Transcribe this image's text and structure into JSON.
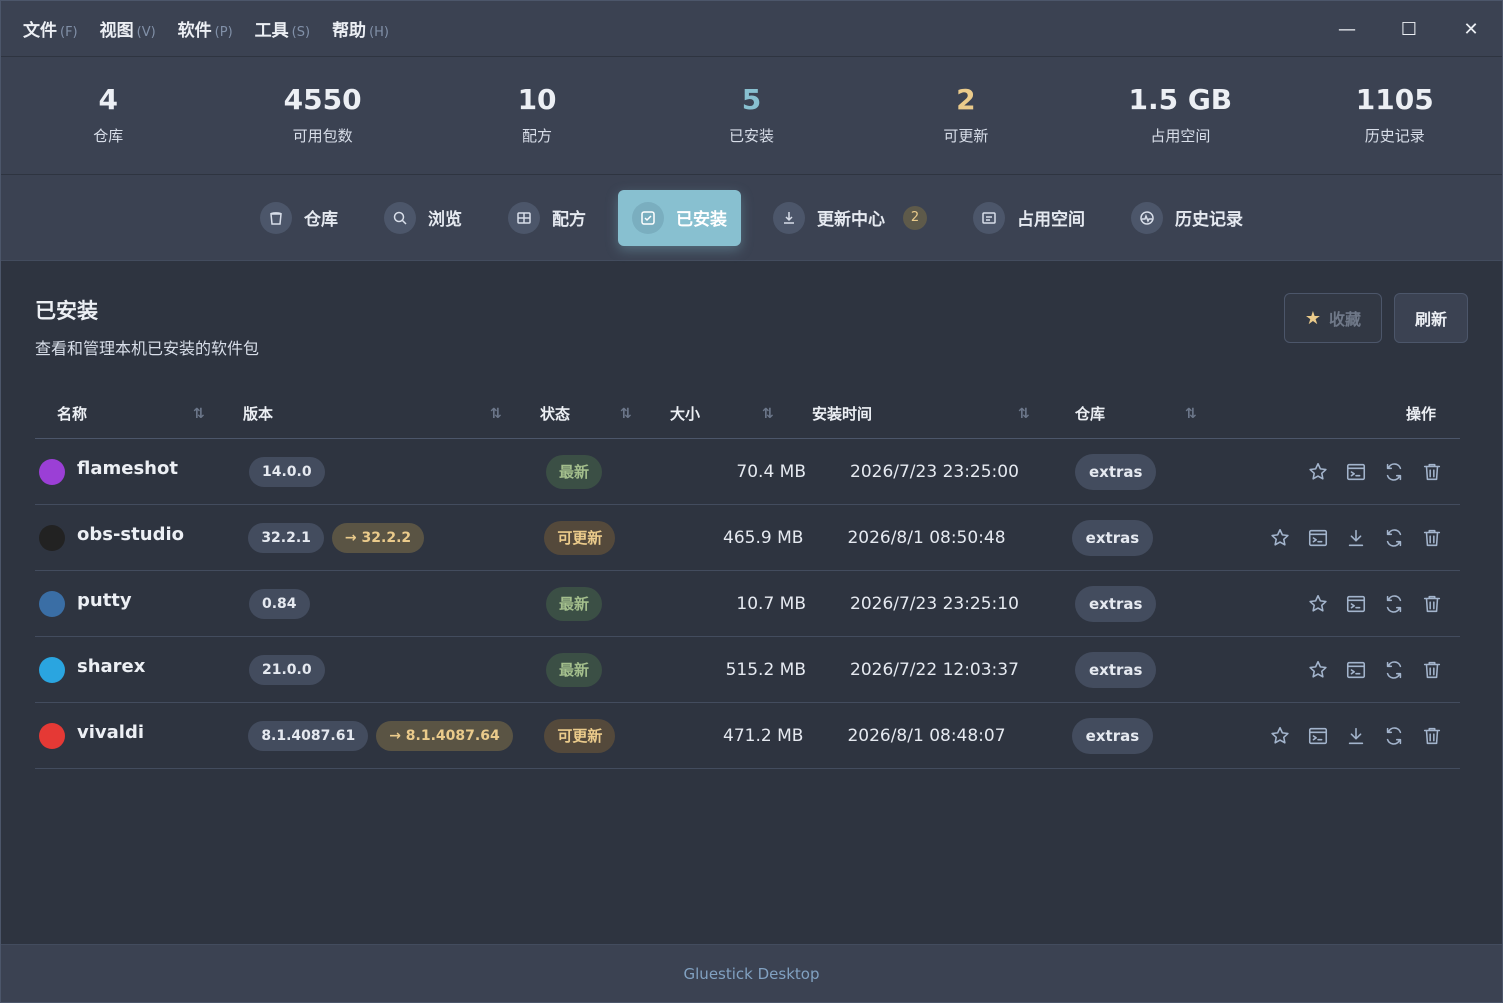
{
  "menu": [
    {
      "label": "文件",
      "key": "(F)"
    },
    {
      "label": "视图",
      "key": "(V)"
    },
    {
      "label": "软件",
      "key": "(P)"
    },
    {
      "label": "工具",
      "key": "(S)"
    },
    {
      "label": "帮助",
      "key": "(H)"
    }
  ],
  "window_controls": {
    "minimize": "—",
    "maximize": "☐",
    "close": "✕"
  },
  "stats": [
    {
      "value": "4",
      "label": "仓库",
      "color": "#eceff4"
    },
    {
      "value": "4550",
      "label": "可用包数",
      "color": "#eceff4"
    },
    {
      "value": "10",
      "label": "配方",
      "color": "#eceff4"
    },
    {
      "value": "5",
      "label": "已安装",
      "color": "#88c0d0"
    },
    {
      "value": "2",
      "label": "可更新",
      "color": "#ebcb8b"
    },
    {
      "value": "1.5 GB",
      "label": "占用空间",
      "color": "#eceff4"
    },
    {
      "value": "1105",
      "label": "历史记录",
      "color": "#eceff4"
    }
  ],
  "nav": [
    {
      "label": "仓库",
      "icon": "bucket-icon"
    },
    {
      "label": "浏览",
      "icon": "search-icon"
    },
    {
      "label": "配方",
      "icon": "recipe-icon"
    },
    {
      "label": "已安装",
      "icon": "installed-icon"
    },
    {
      "label": "更新中心",
      "icon": "download-icon",
      "badge": "2"
    },
    {
      "label": "占用空间",
      "icon": "storage-icon"
    },
    {
      "label": "历史记录",
      "icon": "history-icon"
    }
  ],
  "page": {
    "title": "已安装",
    "subtitle": "查看和管理本机已安装的软件包",
    "favorites_label": "收藏",
    "refresh_label": "刷新"
  },
  "table": {
    "headers": {
      "name": "名称",
      "version": "版本",
      "status": "状态",
      "size": "大小",
      "time": "安装时间",
      "repo": "仓库",
      "ops": "操作"
    },
    "sort_glyph": "⇅",
    "rows": [
      {
        "name": "flameshot",
        "version": "14.0.0",
        "new_version": "",
        "status": "最新",
        "status_type": "ok",
        "size": "70.4 MB",
        "time": "2026/7/23 23:25:00",
        "repo": "extras",
        "icon_color": "#9b3fd6"
      },
      {
        "name": "obs-studio",
        "version": "32.2.1",
        "new_version": "→ 32.2.2",
        "status": "可更新",
        "status_type": "upd",
        "size": "465.9 MB",
        "time": "2026/8/1 08:50:48",
        "repo": "extras",
        "icon_color": "#222222"
      },
      {
        "name": "putty",
        "version": "0.84",
        "new_version": "",
        "status": "最新",
        "status_type": "ok",
        "size": "10.7 MB",
        "time": "2026/7/23 23:25:10",
        "repo": "extras",
        "icon_color": "#3a6ea5"
      },
      {
        "name": "sharex",
        "version": "21.0.0",
        "new_version": "",
        "status": "最新",
        "status_type": "ok",
        "size": "515.2 MB",
        "time": "2026/7/22 12:03:37",
        "repo": "extras",
        "icon_color": "#2aa5e0"
      },
      {
        "name": "vivaldi",
        "version": "8.1.4087.61",
        "new_version": "→ 8.1.4087.64",
        "status": "可更新",
        "status_type": "upd",
        "size": "471.2 MB",
        "time": "2026/8/1 08:48:07",
        "repo": "extras",
        "icon_color": "#e53935"
      }
    ]
  },
  "footer": {
    "text": "Gluestick Desktop"
  }
}
